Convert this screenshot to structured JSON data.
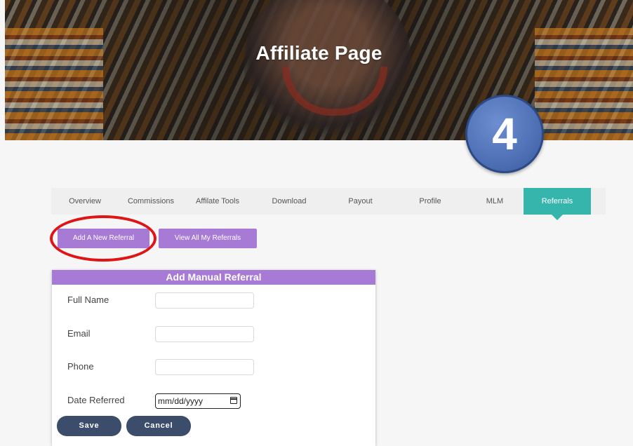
{
  "hero": {
    "title": "Affiliate Page"
  },
  "badge": {
    "number": "4"
  },
  "tabs": [
    {
      "label": "Overview"
    },
    {
      "label": "Commissions"
    },
    {
      "label": "Affilate Tools"
    },
    {
      "label": "Download"
    },
    {
      "label": "Payout"
    },
    {
      "label": "Profile"
    },
    {
      "label": "MLM"
    },
    {
      "label": "Referrals",
      "active": true
    }
  ],
  "actions": {
    "add_referral": "Add A New Referral",
    "view_referrals": "View All My Referrals"
  },
  "form": {
    "title": "Add Manual Referral",
    "full_name_label": "Full Name",
    "email_label": "Email",
    "phone_label": "Phone",
    "date_label": "Date Referred",
    "date_placeholder": "mm/dd/yyyy",
    "save": "Save",
    "cancel": "Cancel"
  },
  "colors": {
    "accent_purple": "#a77ad6",
    "active_tab": "#36b5ac",
    "button_dark": "#3b4d6b",
    "highlight_red": "#e01414",
    "badge_blue": "#4f70b5"
  }
}
